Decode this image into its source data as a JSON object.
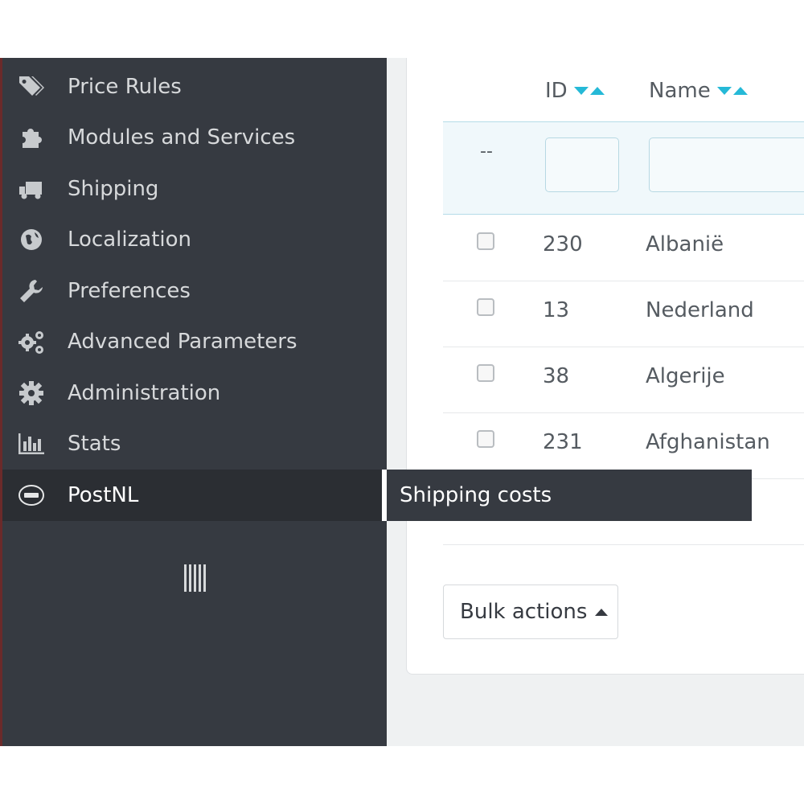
{
  "sidebar": {
    "items": [
      {
        "label": "Price Rules",
        "icon": "tags-icon"
      },
      {
        "label": "Modules and Services",
        "icon": "puzzle-icon"
      },
      {
        "label": "Shipping",
        "icon": "truck-icon"
      },
      {
        "label": "Localization",
        "icon": "globe-icon"
      },
      {
        "label": "Preferences",
        "icon": "wrench-icon"
      },
      {
        "label": "Advanced Parameters",
        "icon": "cogs-icon"
      },
      {
        "label": "Administration",
        "icon": "gear-icon"
      },
      {
        "label": "Stats",
        "icon": "bar-chart-icon"
      },
      {
        "label": "PostNL",
        "icon": "postnl-logo-icon",
        "active": true
      }
    ]
  },
  "submenu": {
    "label": "Shipping costs"
  },
  "table": {
    "columns": {
      "id": "ID",
      "name": "Name"
    },
    "filter": {
      "dash": "--",
      "id_value": "",
      "name_value": ""
    },
    "rows": [
      {
        "id": "230",
        "name": "Albanië"
      },
      {
        "id": "13",
        "name": "Nederland"
      },
      {
        "id": "38",
        "name": "Algerije"
      },
      {
        "id": "231",
        "name": "Afghanistan"
      }
    ]
  },
  "bulk": {
    "label": "Bulk actions"
  },
  "colors": {
    "sidebar_bg": "#363a41",
    "active_bg": "#2b2e33",
    "accent": "#25b9d7"
  }
}
